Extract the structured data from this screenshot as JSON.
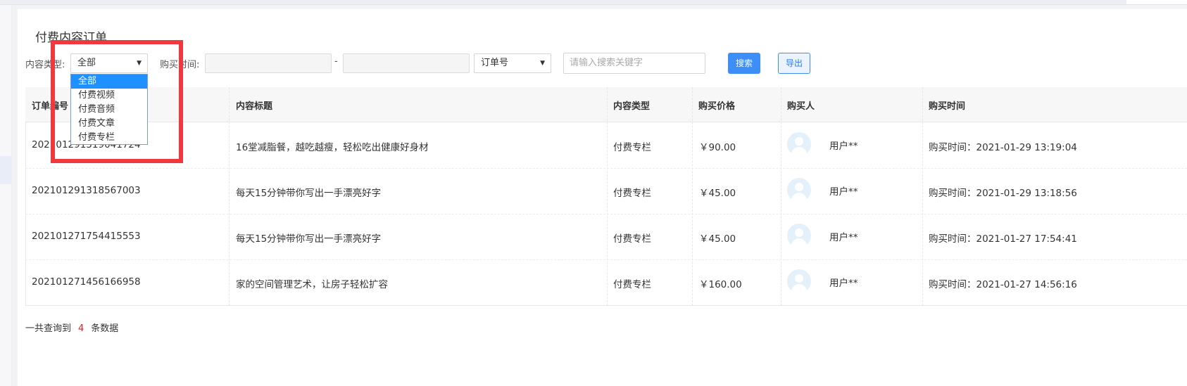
{
  "page": {
    "title": "付费内容订单"
  },
  "filters": {
    "content_type_label": "内容类型:",
    "content_type_value": "全部",
    "content_type_options": [
      "全部",
      "付费视频",
      "付费音频",
      "付费文章",
      "付费专栏"
    ],
    "purchase_time_label": "购买时间:",
    "date_separator": "-",
    "field_select_value": "订单号",
    "search_placeholder": "请输入搜索关键字",
    "search_button": "搜索",
    "export_button": "导出"
  },
  "table": {
    "columns": [
      "订单编号",
      "内容标题",
      "内容类型",
      "购买价格",
      "购买人",
      "购买时间"
    ],
    "rows": [
      {
        "order_no": "202101291319041724",
        "title": "16堂减脂餐，越吃越瘦，轻松吃出健康好身材",
        "type": "付费专栏",
        "price": "￥90.00",
        "buyer": "用户**",
        "time": "购买时间：2021-01-29 13:19:04"
      },
      {
        "order_no": "202101291318567003",
        "title": "每天15分钟带你写出一手漂亮好字",
        "type": "付费专栏",
        "price": "￥45.00",
        "buyer": "用户**",
        "time": "购买时间：2021-01-29 13:18:56"
      },
      {
        "order_no": "202101271754415553",
        "title": "每天15分钟带你写出一手漂亮好字",
        "type": "付费专栏",
        "price": "￥45.00",
        "buyer": "用户**",
        "time": "购买时间：2021-01-27 17:54:41"
      },
      {
        "order_no": "202101271456166958",
        "title": "家的空间管理艺术，让房子轻松扩容",
        "type": "付费专栏",
        "price": "￥160.00",
        "buyer": "用户**",
        "time": "购买时间：2021-01-27 14:56:16"
      }
    ]
  },
  "summary": {
    "prefix": "一共查询到",
    "count": "4",
    "suffix": "条数据"
  },
  "colors": {
    "primary": "#3e8ef7",
    "highlight": "#f0393f",
    "count": "#e02020"
  }
}
